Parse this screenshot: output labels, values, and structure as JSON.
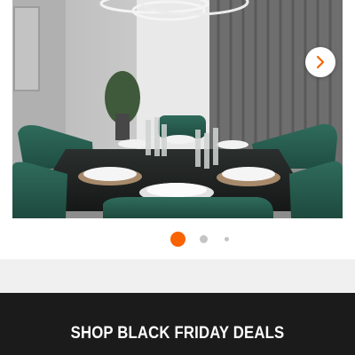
{
  "carousel": {
    "slide_image": "dining-room-photo",
    "next_icon": "chevron-right-icon",
    "accent_color": "#f96302",
    "slide_count": 3,
    "active_slide": 1
  },
  "promo": {
    "label": "SHOP BLACK FRIDAY DEALS",
    "background": "#1b1b1b"
  }
}
